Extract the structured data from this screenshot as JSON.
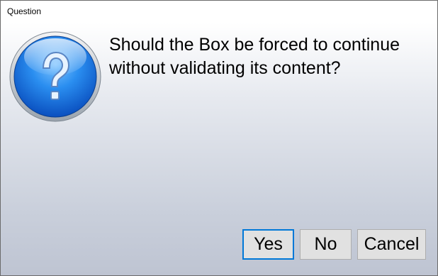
{
  "window": {
    "title": "Question"
  },
  "dialog": {
    "message": "Should the Box be forced to continue without validating its content?",
    "icon": "question-icon"
  },
  "buttons": {
    "yes_label": "Yes",
    "no_label": "No",
    "cancel_label": "Cancel"
  },
  "colors": {
    "accent": "#0078d7",
    "button_face": "#e1e1e1",
    "icon_blue": "#1e6fd8"
  }
}
